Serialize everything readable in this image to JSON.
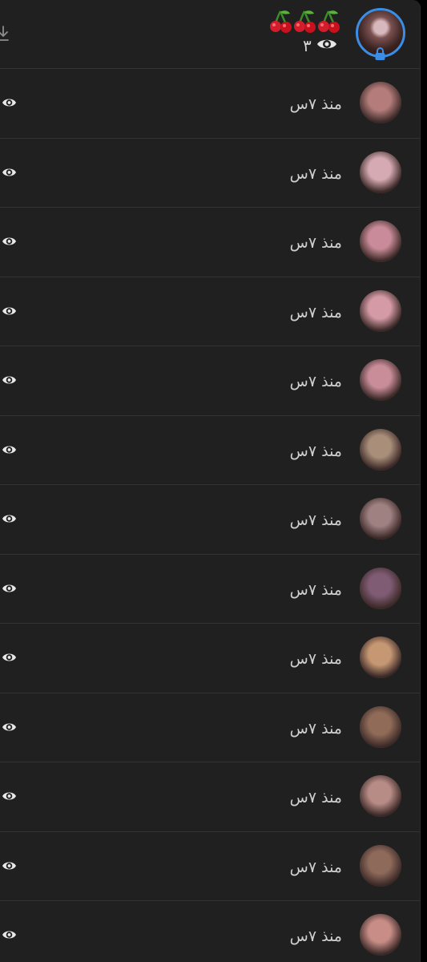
{
  "header": {
    "view_count": "٣",
    "emojis": [
      "cherry-emoji",
      "cherry-emoji",
      "cherry-emoji"
    ],
    "icons": {
      "download": "download-icon",
      "view": "eye-icon",
      "lock": "lock-icon"
    },
    "colors": {
      "avatar_ring": "#3a8ee6",
      "panel_bg": "#202020",
      "text": "#d7d7d7"
    }
  },
  "viewers": [
    {
      "time": "منذ ٧س",
      "avatar_color": "#b47d7b"
    },
    {
      "time": "منذ ٧س",
      "avatar_color": "#d5aab2"
    },
    {
      "time": "منذ ٧س",
      "avatar_color": "#c98b99"
    },
    {
      "time": "منذ ٧س",
      "avatar_color": "#d49aa5"
    },
    {
      "time": "منذ ٧س",
      "avatar_color": "#c98d9a"
    },
    {
      "time": "منذ ٧س",
      "avatar_color": "#a98e7a"
    },
    {
      "time": "منذ ٧س",
      "avatar_color": "#9f8182"
    },
    {
      "time": "منذ ٧س",
      "avatar_color": "#7f5b74"
    },
    {
      "time": "منذ ٧س",
      "avatar_color": "#c59773"
    },
    {
      "time": "منذ ٧س",
      "avatar_color": "#8f6b58"
    },
    {
      "time": "منذ ٧س",
      "avatar_color": "#b88c86"
    },
    {
      "time": "منذ ٧س",
      "avatar_color": "#8e6a5b"
    },
    {
      "time": "منذ ٧س",
      "avatar_color": "#c78d86"
    }
  ]
}
